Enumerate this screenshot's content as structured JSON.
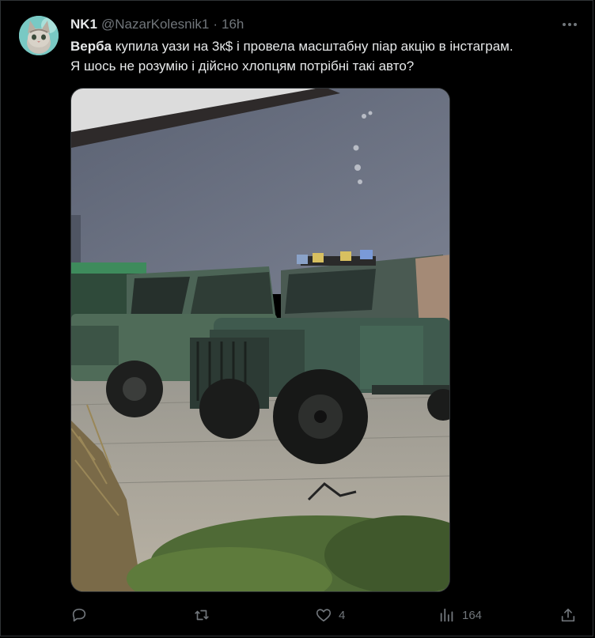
{
  "tweet": {
    "display_name": "NK1",
    "handle": "@NazarKolesnik1",
    "separator": "·",
    "time": "16h",
    "text_bold": "Верба",
    "text_line1_rest": " купила уази на 3к$ і провела масштабну піар акцію в інстаграм.",
    "text_line2": "Я шось не розумію і дійсно хлопцям потрібні такі авто?"
  },
  "media": {
    "icon": "photo"
  },
  "actions": {
    "reply": {
      "icon": "reply-icon",
      "count": ""
    },
    "retweet": {
      "icon": "retweet-icon",
      "count": ""
    },
    "like": {
      "icon": "heart-icon",
      "count": "4"
    },
    "views": {
      "icon": "views-icon",
      "count": "164"
    },
    "share": {
      "icon": "share-icon"
    }
  },
  "colors": {
    "background": "#000000",
    "text": "#e7e9ea",
    "muted": "#71767b",
    "border": "#2f3336"
  }
}
